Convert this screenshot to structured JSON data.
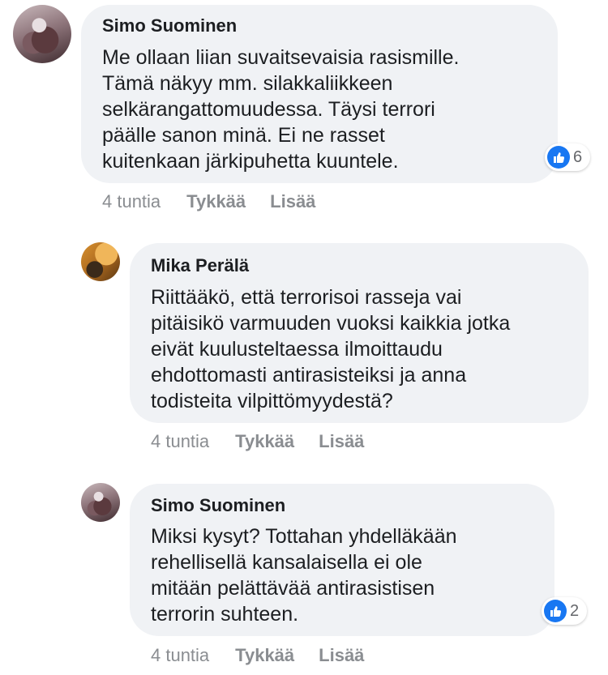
{
  "comments": [
    {
      "author": "Simo Suominen",
      "text": "Me ollaan liian suvaitsevaisia rasismille.\nTämä näkyy mm. silakkaliikkeen\nselkärangattomuudessa. Täysi terrori\npäälle sanon minä. Ei ne rasset\nkuitenkaan järkipuhetta kuuntele.",
      "time": "4 tuntia",
      "like_label": "Tykkää",
      "more_label": "Lisää",
      "reaction_count": "6"
    },
    {
      "author": "Mika Perälä",
      "text": "Riittääkö, että terrorisoi rasseja vai\npitäisikö varmuuden vuoksi kaikkia jotka\neivät kuulusteltaessa ilmoittaudu\nehdottomasti antirasisteiksi ja anna\ntodisteita vilpittömyydestä?",
      "time": "4 tuntia",
      "like_label": "Tykkää",
      "more_label": "Lisää"
    },
    {
      "author": "Simo Suominen",
      "text": "Miksi kysyt? Tottahan yhdelläkään\nrehellisellä kansalaisella ei ole\nmitään pelättävää antirasistisen\nterrorin suhteen.",
      "time": "4 tuntia",
      "like_label": "Tykkää",
      "more_label": "Lisää",
      "reaction_count": "2"
    }
  ],
  "icons": {
    "reaction": "like-thumbs-up-icon"
  },
  "colors": {
    "bubble": "#f0f2f5",
    "like_blue": "#1877f2",
    "meta_text": "#8a8d91"
  }
}
